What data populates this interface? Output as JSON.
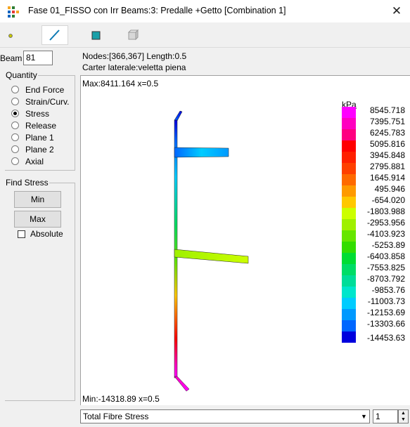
{
  "window": {
    "title": "Fase 01_FISSO con Irr Beams:3: Predalle +Getto [Combination 1]",
    "close_glyph": "✕",
    "app_icon_colors": [
      "#f5a623",
      "#2e7d32",
      "#1565c0",
      "#e53935"
    ]
  },
  "toolbar": {
    "buttons": [
      {
        "name": "node-view-icon",
        "active": false
      },
      {
        "name": "line-view-icon",
        "active": true
      },
      {
        "name": "plate-view-icon",
        "active": false
      },
      {
        "name": "solid-view-icon",
        "active": false
      }
    ]
  },
  "beam": {
    "label": "Beam",
    "value": "81"
  },
  "info": {
    "nodes": "Nodes:[366,367]   Length:0.5",
    "description": "Carter laterale:veletta piena"
  },
  "quantity": {
    "legend": "Quantity",
    "options": [
      "End Force",
      "Strain/Curv.",
      "Stress",
      "Release",
      "Plane 1",
      "Plane 2",
      "Axial"
    ],
    "selected": "Stress"
  },
  "find_stress": {
    "legend": "Find Stress",
    "min_label": "Min",
    "max_label": "Max",
    "absolute_label": "Absolute",
    "absolute_checked": false
  },
  "plot": {
    "max_text": "Max:8411.164 x=0.5",
    "min_text": "Min:-14318.89 x=0.5",
    "unit": "kPa",
    "legend_values": [
      "8545.718",
      "7395.751",
      "6245.783",
      "5095.816",
      "3945.848",
      "2795.881",
      "1645.914",
      "495.946",
      "-654.020",
      "-1803.988",
      "-2953.956",
      "-4103.923",
      "-5253.89",
      "-6403.858",
      "-7553.825",
      "-8703.792",
      "-9853.76",
      "-11003.73",
      "-12153.69",
      "-13303.66",
      "-14453.63"
    ],
    "legend_colors": [
      "#ff00ff",
      "#ff00c0",
      "#ff0080",
      "#ff0000",
      "#ff2000",
      "#ff4000",
      "#ff6a00",
      "#ff9a00",
      "#ffc800",
      "#ccff00",
      "#9ff000",
      "#66e600",
      "#33dd00",
      "#00dd33",
      "#00dd66",
      "#00dd99",
      "#00e6cc",
      "#00ccff",
      "#0099ff",
      "#0066ff",
      "#0000dd"
    ]
  },
  "bottom": {
    "output_selected": "Total Fibre Stress",
    "page": "1"
  }
}
